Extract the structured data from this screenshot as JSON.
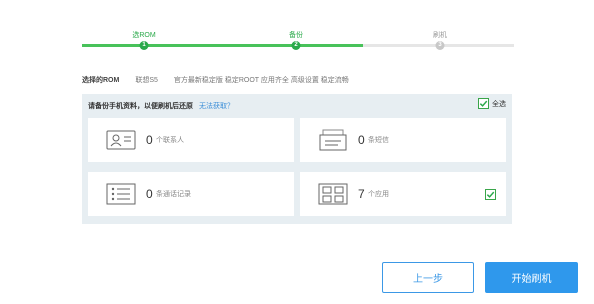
{
  "stepper": {
    "steps": [
      {
        "label": "选ROM",
        "number": "1",
        "status": "done"
      },
      {
        "label": "备份",
        "number": "2",
        "status": "active"
      },
      {
        "label": "刷机",
        "number": "3",
        "status": "pending"
      }
    ],
    "progress_percent": 65
  },
  "info": {
    "label": "选择的ROM",
    "model": "联想S5",
    "description": "官方最新稳定版 稳定ROOT 应用齐全 高级设置 稳定流畅"
  },
  "panel": {
    "title": "请备份手机资料，以便刷机后还原",
    "help_link": "无法获取？",
    "select_all_label": "全选",
    "select_all_checked": true
  },
  "items": [
    {
      "icon": "contact-card-icon",
      "count": "0",
      "unit": "个联系人",
      "checked": false
    },
    {
      "icon": "message-envelope-icon",
      "count": "0",
      "unit": "条短信",
      "checked": false
    },
    {
      "icon": "call-log-list-icon",
      "count": "0",
      "unit": "条通话记录",
      "checked": false
    },
    {
      "icon": "apps-grid-icon",
      "count": "7",
      "unit": "个应用",
      "checked": true
    }
  ],
  "buttons": {
    "prev": "上一步",
    "start": "开始刷机"
  },
  "colors": {
    "accent_green": "#2aa94a",
    "accent_blue": "#2f98ec",
    "panel_bg": "#e7eef2"
  }
}
